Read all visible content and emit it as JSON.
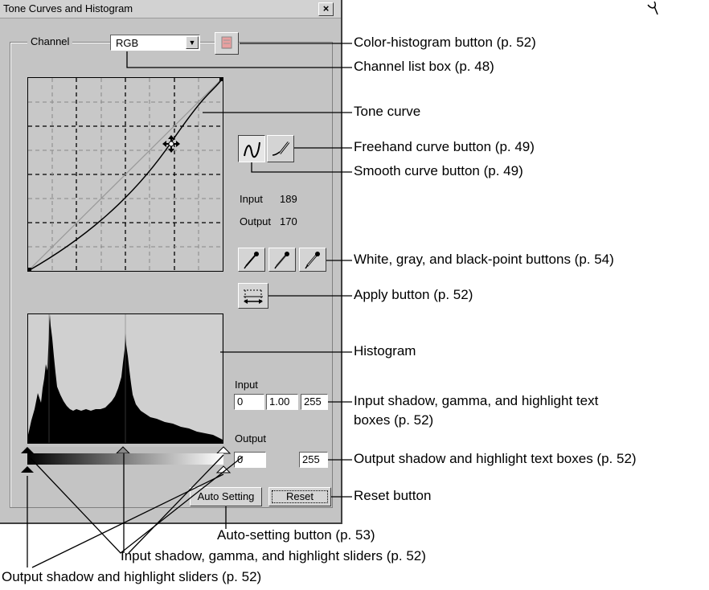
{
  "window": {
    "title": "Tone Curves and Histogram",
    "close_label": "×",
    "channel_label": "Channel",
    "channel_value": "RGB",
    "input_readout_label": "Input",
    "input_readout_value": "189",
    "output_readout_label": "Output",
    "output_readout_value": "170",
    "input_section_label": "Input",
    "input_shadow": "0",
    "input_gamma": "1.00",
    "input_highlight": "255",
    "output_section_label": "Output",
    "output_shadow": "0",
    "output_highlight": "255",
    "auto_setting_label": "Auto Setting",
    "reset_label": "Reset"
  },
  "callouts": {
    "color_histogram": "Color-histogram button (p. 52)",
    "channel_list": "Channel list box (p. 48)",
    "tone_curve": "Tone curve",
    "freehand": "Freehand curve button (p. 49)",
    "smooth": "Smooth curve button (p. 49)",
    "point_buttons": "White, gray, and black-point buttons (p. 54)",
    "apply": "Apply button (p. 52)",
    "histogram": "Histogram",
    "input_boxes_1": "Input shadow, gamma, and highlight text",
    "input_boxes_2": "boxes (p. 52)",
    "output_boxes": "Output shadow and highlight text boxes (p. 52)",
    "reset": "Reset button",
    "auto_setting": "Auto-setting button (p. 53)",
    "input_sliders": "Input shadow, gamma, and highlight sliders (p. 52)",
    "output_sliders": "Output shadow and highlight sliders (p. 52)"
  },
  "colors": {
    "window_bg": "#c4c4c4",
    "histogram": "#000000"
  }
}
